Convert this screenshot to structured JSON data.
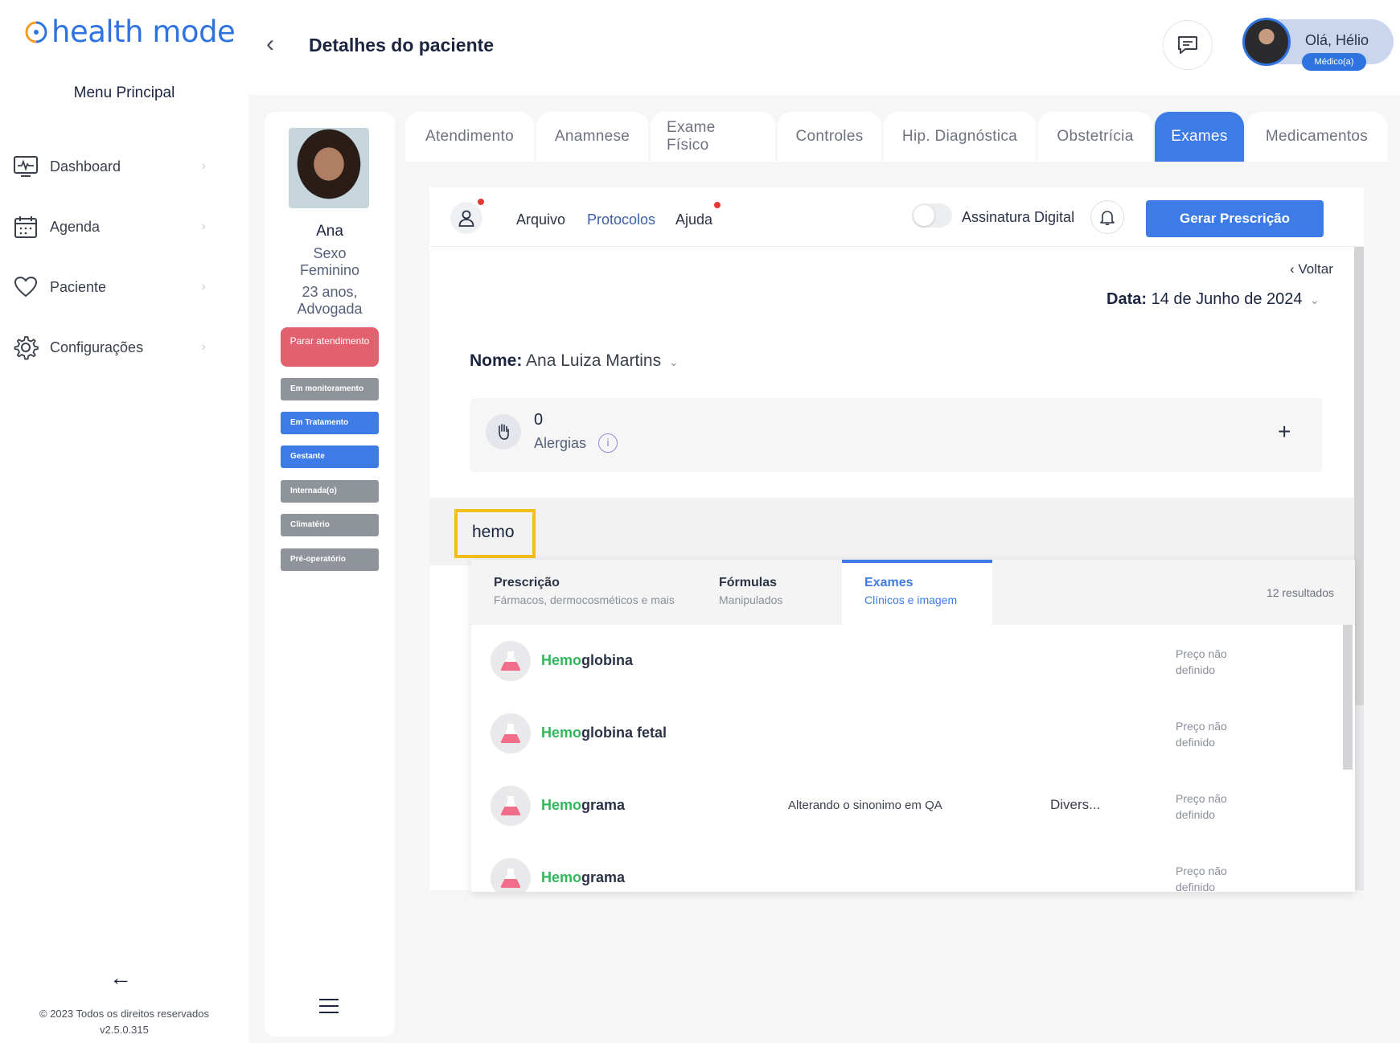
{
  "brand": {
    "logo_text": "health mode",
    "accent": "#2f73e0"
  },
  "sidebar": {
    "menu_title": "Menu Principal",
    "items": [
      {
        "label": "Dashboard",
        "icon": "monitor-icon"
      },
      {
        "label": "Agenda",
        "icon": "calendar-icon"
      },
      {
        "label": "Paciente",
        "icon": "heart-icon"
      },
      {
        "label": "Configurações",
        "icon": "gear-icon"
      }
    ],
    "copyright": "© 2023 Todos os direitos reservados",
    "version": "v2.5.0.315"
  },
  "header": {
    "title": "Detalhes do paciente",
    "greeting": "Olá, Hélio",
    "role": "Médico(a)"
  },
  "patient": {
    "name": "Ana",
    "sex_label": "Sexo",
    "sex_value": "Feminino",
    "age": "23 anos,",
    "occupation": "Advogada",
    "stop_button": "Parar atendimento",
    "tags": [
      {
        "label": "Em monitoramento",
        "color": "#8f949b"
      },
      {
        "label": "Em Tratamento",
        "color": "#3d7be6"
      },
      {
        "label": "Gestante",
        "color": "#3d7be6"
      },
      {
        "label": "Internada(o)",
        "color": "#8f949b"
      },
      {
        "label": "Climatério",
        "color": "#8f949b"
      },
      {
        "label": "Pré-operatório",
        "color": "#8f949b"
      }
    ]
  },
  "tabs": {
    "items": [
      "Atendimento",
      "Anamnese",
      "Exame Físico",
      "Controles",
      "Hip. Diagnóstica",
      "Obstetrícia",
      "Exames",
      "Medicamentos"
    ],
    "active": "Exames"
  },
  "toolbar": {
    "arquivo": "Arquivo",
    "protocolos": "Protocolos",
    "ajuda": "Ajuda",
    "signature_label": "Assinatura Digital",
    "signature_on": false,
    "generate_button": "Gerar Prescrição"
  },
  "form": {
    "back_link": "Voltar",
    "date_label": "Data:",
    "date_value": "14 de Junho de 2024",
    "name_label": "Nome:",
    "name_value": "Ana Luiza Martins",
    "allergy_count": "0",
    "allergy_label": "Alergias",
    "search_value": "hemo"
  },
  "results": {
    "tabs": [
      {
        "title": "Prescrição",
        "subtitle": "Fármacos, dermocosméticos e mais"
      },
      {
        "title": "Fórmulas",
        "subtitle": "Manipulados"
      },
      {
        "title": "Exames",
        "subtitle": "Clínicos e imagem"
      }
    ],
    "active_tab": "Exames",
    "count": "12 resultados",
    "highlight_color": "#2fb95a",
    "items": [
      {
        "match": "Hemo",
        "rest": "globina",
        "synonym": "",
        "category": "",
        "price": "Preço não definido"
      },
      {
        "match": "Hemo",
        "rest": "globina fetal",
        "synonym": "",
        "category": "",
        "price": "Preço não definido"
      },
      {
        "match": "Hemo",
        "rest": "grama",
        "synonym": "Alterando o sinonimo em QA",
        "category": "Divers...",
        "price": "Preço não definido"
      },
      {
        "match": "Hemo",
        "rest": "grama",
        "synonym": "",
        "category": "",
        "price": "Preço não definido"
      }
    ]
  }
}
